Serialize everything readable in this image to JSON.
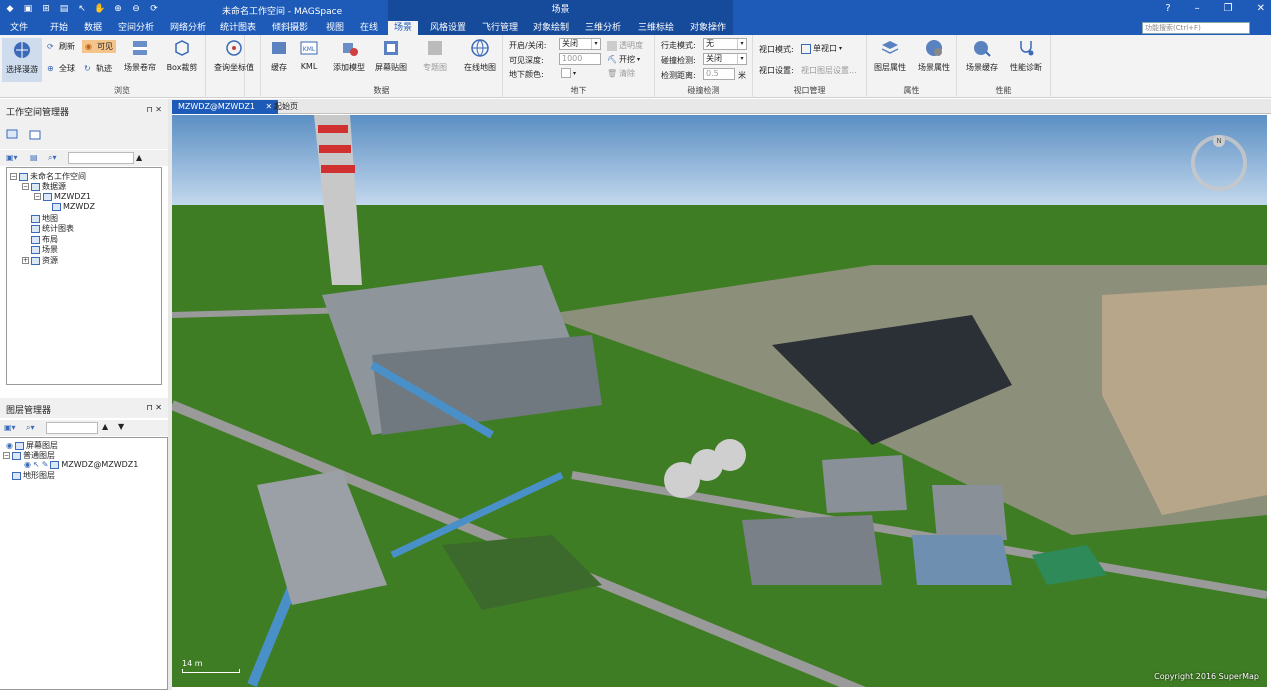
{
  "app": {
    "window_title": "未命名工作空间 - MAGSpace",
    "context_tab_group": "场景"
  },
  "tabs": [
    "文件",
    "开始",
    "数据",
    "空间分析",
    "网络分析",
    "统计图表",
    "倾斜摄影",
    "视图",
    "在线",
    "场景",
    "风格设置",
    "飞行管理",
    "对象绘制",
    "三维分析",
    "三维标绘",
    "对象操作"
  ],
  "active_tab": "场景",
  "search_placeholder": "功能搜索(Ctrl+F)",
  "ribbon": {
    "browse": {
      "label": "浏览",
      "select_roam": "选择漫游",
      "refresh": "刷新",
      "visible": "可见",
      "full_globe": "全球",
      "track": "轨迹",
      "scene_shutter": "场景卷帘",
      "box_clip": "Box裁剪"
    },
    "query": {
      "label": "查询坐标值"
    },
    "data": {
      "label": "数据",
      "cache": "缓存",
      "kml": "KML",
      "add_model": "添加模型",
      "screen_tile": "屏幕贴图",
      "thematic": "专题图",
      "online_map": "在线地图"
    },
    "underground": {
      "label": "地下",
      "toggle_label": "开启/关闭:",
      "toggle_value": "关闭",
      "depth_label": "可见深度:",
      "depth_value": "1000",
      "color_label": "地下颜色:",
      "transparency": "透明度",
      "excavate": "开挖",
      "clear": "清除"
    },
    "collision": {
      "label": "碰撞检测",
      "walk_label": "行走模式:",
      "walk_value": "无",
      "detect_label": "碰撞检测:",
      "detect_value": "关闭",
      "distance_label": "检测距离:",
      "distance_value": "0.5",
      "distance_unit": "米"
    },
    "viewport": {
      "label": "视口管理",
      "mode_label": "视口模式:",
      "mode_value": "单视口",
      "settings_label": "视口设置:",
      "settings_value": "视口图层设置..."
    },
    "properties": {
      "label": "属性",
      "layer_props": "图层属性",
      "scene_props": "场景属性"
    },
    "performance": {
      "label": "性能",
      "scene_cache": "场景缓存",
      "perf_diag": "性能诊断"
    }
  },
  "workspace_manager": {
    "title": "工作空间管理器",
    "tree": [
      {
        "label": "未命名工作空间",
        "level": 0
      },
      {
        "label": "数据源",
        "level": 1
      },
      {
        "label": "MZWDZ1",
        "level": 2
      },
      {
        "label": "MZWDZ",
        "level": 3
      },
      {
        "label": "地图",
        "level": 1
      },
      {
        "label": "统计图表",
        "level": 1
      },
      {
        "label": "布局",
        "level": 1
      },
      {
        "label": "场景",
        "level": 1
      },
      {
        "label": "资源",
        "level": 1
      }
    ]
  },
  "layer_manager": {
    "title": "图层管理器",
    "tree": [
      {
        "label": "屏幕图层",
        "level": 0
      },
      {
        "label": "普通图层",
        "level": 0
      },
      {
        "label": "MZWDZ@MZWDZ1",
        "level": 1
      },
      {
        "label": "地形图层",
        "level": 0
      }
    ]
  },
  "doc_tabs": [
    {
      "label": "MZWDZ@MZWDZ1",
      "active": true
    },
    {
      "label": "起始页",
      "active": false
    }
  ],
  "scene": {
    "scale": "14 m",
    "copyright": "Copyright 2016 SuperMap",
    "compass_label": "N"
  },
  "colors": {
    "title_blue": "#1e5bb8",
    "ribbon_bg": "#f3f3f3",
    "sky_top": "#5b8fc4",
    "sky_bottom": "#c9dcef",
    "grass": "#3f7d24"
  }
}
